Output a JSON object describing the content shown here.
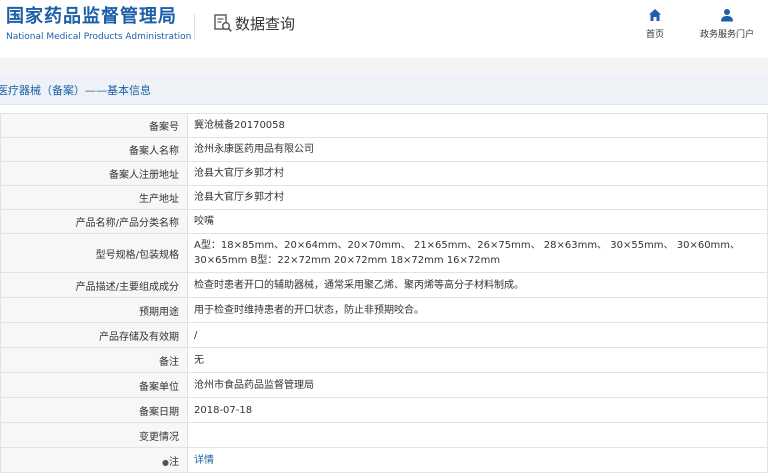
{
  "header": {
    "logo_cn": "国家药品监督管理局",
    "logo_en": "National Medical Products Administration",
    "query_label": "数据查询",
    "nav": [
      {
        "label": "首页",
        "icon": "home-icon"
      },
      {
        "label": "政务服务门户",
        "icon": "user-icon"
      }
    ]
  },
  "breadcrumb": "医疗器械（备案）——基本信息",
  "rows": [
    {
      "key": "备案号",
      "value": "冀沧械备20170058"
    },
    {
      "key": "备案人名称",
      "value": "沧州永康医药用品有限公司"
    },
    {
      "key": "备案人注册地址",
      "value": "沧县大官厅乡郭才村"
    },
    {
      "key": "生产地址",
      "value": "沧县大官厅乡郭才村"
    },
    {
      "key": "产品名称/产品分类名称",
      "value": "咬嘴"
    },
    {
      "key": "型号规格/包装规格",
      "value": "A型：18×85mm、20×64mm、20×70mm、 21×65mm、26×75mm、 28×63mm、 30×55mm、 30×60mm、 30×65mm B型：22×72mm 20×72mm 18×72mm 16×72mm"
    },
    {
      "key": "产品描述/主要组成成分",
      "value": "检查时患者开口的辅助器械，通常采用聚乙烯、聚丙烯等高分子材料制成。"
    },
    {
      "key": "预期用途",
      "value": "用于检查时维持患者的开口状态，防止非预期咬合。"
    },
    {
      "key": "产品存储及有效期",
      "value": "/"
    },
    {
      "key": "备注",
      "value": "无"
    },
    {
      "key": "备案单位",
      "value": "沧州市食品药品监督管理局"
    },
    {
      "key": "备案日期",
      "value": "2018-07-18"
    },
    {
      "key": "变更情况",
      "value": ""
    },
    {
      "key": "注",
      "value": "详情"
    }
  ],
  "colors": {
    "brand": "#1d5fa8",
    "key_bg": "#f7f7f7",
    "border": "#e2e2e2"
  }
}
